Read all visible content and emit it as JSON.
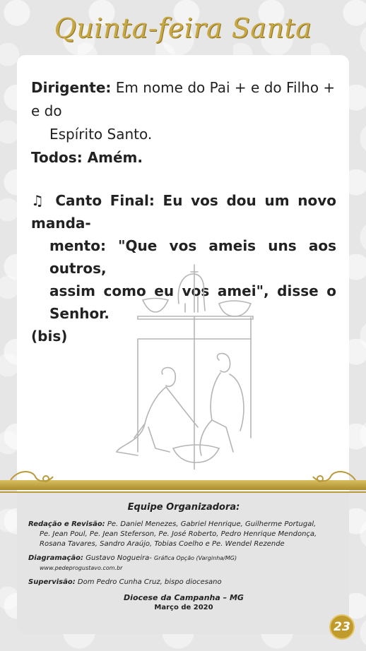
{
  "header": {
    "title": "Quinta-feira Santa"
  },
  "liturgy": {
    "dirigente_label": "Dirigente:",
    "dirigente_text_1": "Em nome do Pai + e do Filho + e do",
    "dirigente_text_2": "Espírito Santo.",
    "todos_label": "Todos:",
    "todos_text": "Amém."
  },
  "song": {
    "icon": "music-note-icon",
    "glyph": "♫",
    "line1": "Canto Final: Eu vos dou um novo manda-",
    "line2": "mento: \"Que vos ameis uns aos outros,",
    "line3": "assim como eu vos amei\", disse o Senhor.",
    "line4": "(bis)"
  },
  "footer": {
    "heading": "Equipe Organizadora:",
    "redacao_label": "Redação e Revisão:",
    "redacao_text_1": "Pe. Daniel Menezes, Gabriel Henrique, Guilherme Portugal,",
    "redacao_text_2": "Pe. Jean Poul, Pe. Jean Steferson, Pe. José Roberto, Pedro Henrique Mendonça,",
    "redacao_text_3": "Rosana Tavares, Sandro Araújo, Tobias Coelho e Pe. Wendel Rezende",
    "diagramacao_label": "Diagramação:",
    "diagramacao_text": "Gustavo Nogueira-",
    "grafica_text": "Gráfica Opção (Varginha/MG)",
    "website": "www.pedeprogustavo.com.br",
    "supervisao_label": "Supervisão:",
    "supervisao_text": "Dom Pedro Cunha Cruz, bispo diocesano",
    "diocese": "Diocese da Campanha – MG",
    "date": "Março de 2020"
  },
  "page_number": "23",
  "colors": {
    "gold": "#c8a842",
    "badge": "#c09a2a",
    "text": "#222222"
  }
}
